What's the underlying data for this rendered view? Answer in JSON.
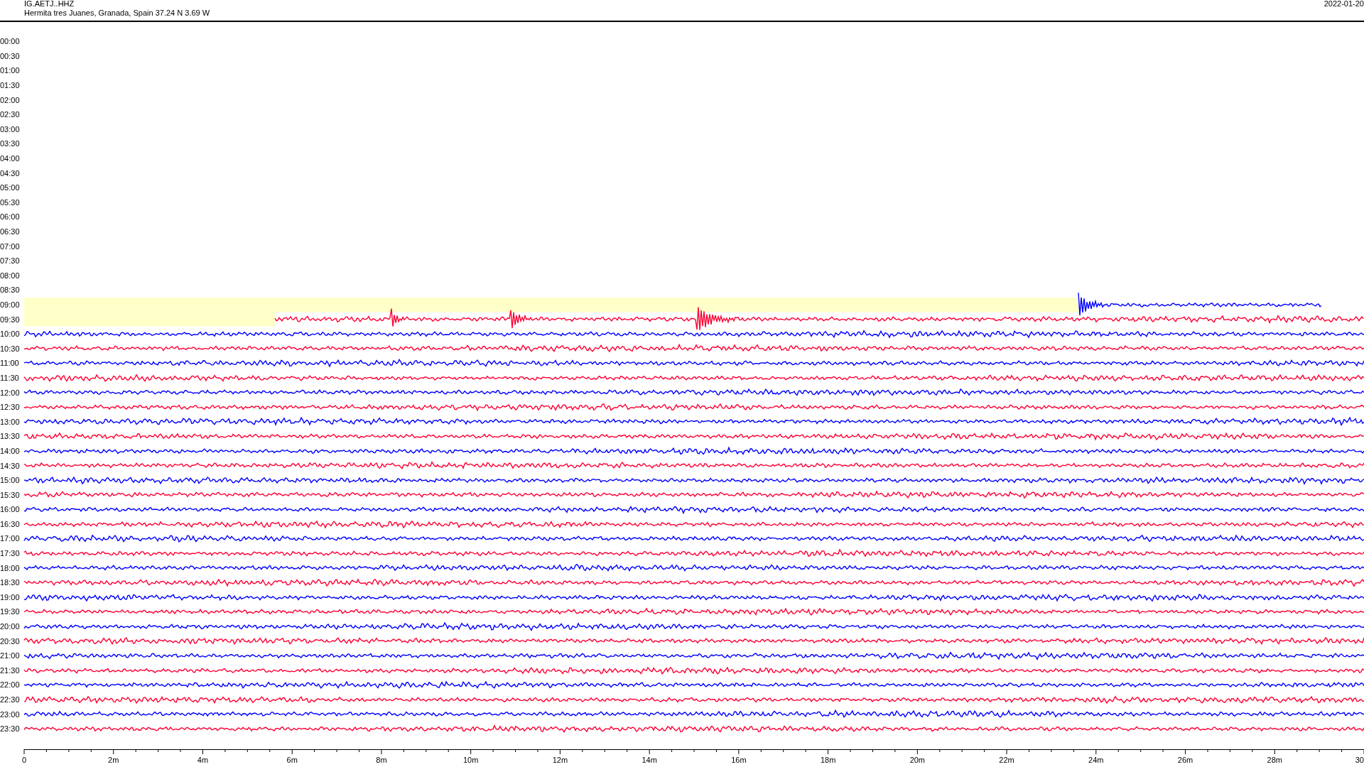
{
  "header": {
    "station": "IG.AETJ..HHZ",
    "location": "Hermita tres Juanes, Granada, Spain  37.24 N 3.69 W",
    "date": "2022-01-20"
  },
  "rows": [
    {
      "label": "00:00",
      "kind": "empty",
      "highlighted": false
    },
    {
      "label": "00:30",
      "kind": "empty",
      "highlighted": false
    },
    {
      "label": "01:00",
      "kind": "empty",
      "highlighted": false
    },
    {
      "label": "01:30",
      "kind": "empty",
      "highlighted": false
    },
    {
      "label": "02:00",
      "kind": "empty",
      "highlighted": false
    },
    {
      "label": "02:30",
      "kind": "empty",
      "highlighted": false
    },
    {
      "label": "03:00",
      "kind": "empty",
      "highlighted": false
    },
    {
      "label": "03:30",
      "kind": "empty",
      "highlighted": false
    },
    {
      "label": "04:00",
      "kind": "empty",
      "highlighted": false
    },
    {
      "label": "04:30",
      "kind": "empty",
      "highlighted": false
    },
    {
      "label": "05:00",
      "kind": "empty",
      "highlighted": false
    },
    {
      "label": "05:30",
      "kind": "empty",
      "highlighted": false
    },
    {
      "label": "06:00",
      "kind": "empty",
      "highlighted": false
    },
    {
      "label": "06:30",
      "kind": "empty",
      "highlighted": false
    },
    {
      "label": "07:00",
      "kind": "empty",
      "highlighted": false
    },
    {
      "label": "07:30",
      "kind": "empty",
      "highlighted": false
    },
    {
      "label": "08:00",
      "kind": "empty",
      "highlighted": false
    },
    {
      "label": "08:30",
      "kind": "empty",
      "highlighted": false
    },
    {
      "label": "09:00",
      "kind": "latest",
      "highlighted": true,
      "color": "#0000ff"
    },
    {
      "label": "09:30",
      "kind": "late_start",
      "highlighted": true,
      "color": "#ff0033"
    },
    {
      "label": "10:00",
      "kind": "full",
      "highlighted": false,
      "color": "#0000ff"
    },
    {
      "label": "10:30",
      "kind": "full",
      "highlighted": false,
      "color": "#ff0033"
    },
    {
      "label": "11:00",
      "kind": "full",
      "highlighted": false,
      "color": "#0000ff"
    },
    {
      "label": "11:30",
      "kind": "full",
      "highlighted": false,
      "color": "#ff0033"
    },
    {
      "label": "12:00",
      "kind": "full",
      "highlighted": false,
      "color": "#0000ff"
    },
    {
      "label": "12:30",
      "kind": "full",
      "highlighted": false,
      "color": "#ff0033"
    },
    {
      "label": "13:00",
      "kind": "full",
      "highlighted": false,
      "color": "#0000ff"
    },
    {
      "label": "13:30",
      "kind": "full",
      "highlighted": false,
      "color": "#ff0033"
    },
    {
      "label": "14:00",
      "kind": "full",
      "highlighted": false,
      "color": "#0000ff"
    },
    {
      "label": "14:30",
      "kind": "full",
      "highlighted": false,
      "color": "#ff0033"
    },
    {
      "label": "15:00",
      "kind": "full",
      "highlighted": false,
      "color": "#0000ff"
    },
    {
      "label": "15:30",
      "kind": "full",
      "highlighted": false,
      "color": "#ff0033"
    },
    {
      "label": "16:00",
      "kind": "full",
      "highlighted": false,
      "color": "#0000ff"
    },
    {
      "label": "16:30",
      "kind": "full",
      "highlighted": false,
      "color": "#ff0033"
    },
    {
      "label": "17:00",
      "kind": "full",
      "highlighted": false,
      "color": "#0000ff"
    },
    {
      "label": "17:30",
      "kind": "full",
      "highlighted": false,
      "color": "#ff0033"
    },
    {
      "label": "18:00",
      "kind": "full",
      "highlighted": false,
      "color": "#0000ff"
    },
    {
      "label": "18:30",
      "kind": "full",
      "highlighted": false,
      "color": "#ff0033"
    },
    {
      "label": "19:00",
      "kind": "full",
      "highlighted": false,
      "color": "#0000ff"
    },
    {
      "label": "19:30",
      "kind": "full",
      "highlighted": false,
      "color": "#ff0033"
    },
    {
      "label": "20:00",
      "kind": "full",
      "highlighted": false,
      "color": "#0000ff"
    },
    {
      "label": "20:30",
      "kind": "full",
      "highlighted": false,
      "color": "#ff0033"
    },
    {
      "label": "21:00",
      "kind": "full",
      "highlighted": false,
      "color": "#0000ff"
    },
    {
      "label": "21:30",
      "kind": "full",
      "highlighted": false,
      "color": "#ff0033"
    },
    {
      "label": "22:00",
      "kind": "full",
      "highlighted": false,
      "color": "#0000ff"
    },
    {
      "label": "22:30",
      "kind": "full",
      "highlighted": false,
      "color": "#ff0033"
    },
    {
      "label": "23:00",
      "kind": "full",
      "highlighted": false,
      "color": "#0000ff"
    },
    {
      "label": "23:30",
      "kind": "full",
      "highlighted": false,
      "color": "#ff0033"
    }
  ],
  "axis": {
    "ticks": [
      "0",
      "2m",
      "4m",
      "6m",
      "8m",
      "10m",
      "12m",
      "14m",
      "16m",
      "18m",
      "20m",
      "22m",
      "24m",
      "26m",
      "28m",
      "30"
    ]
  }
}
